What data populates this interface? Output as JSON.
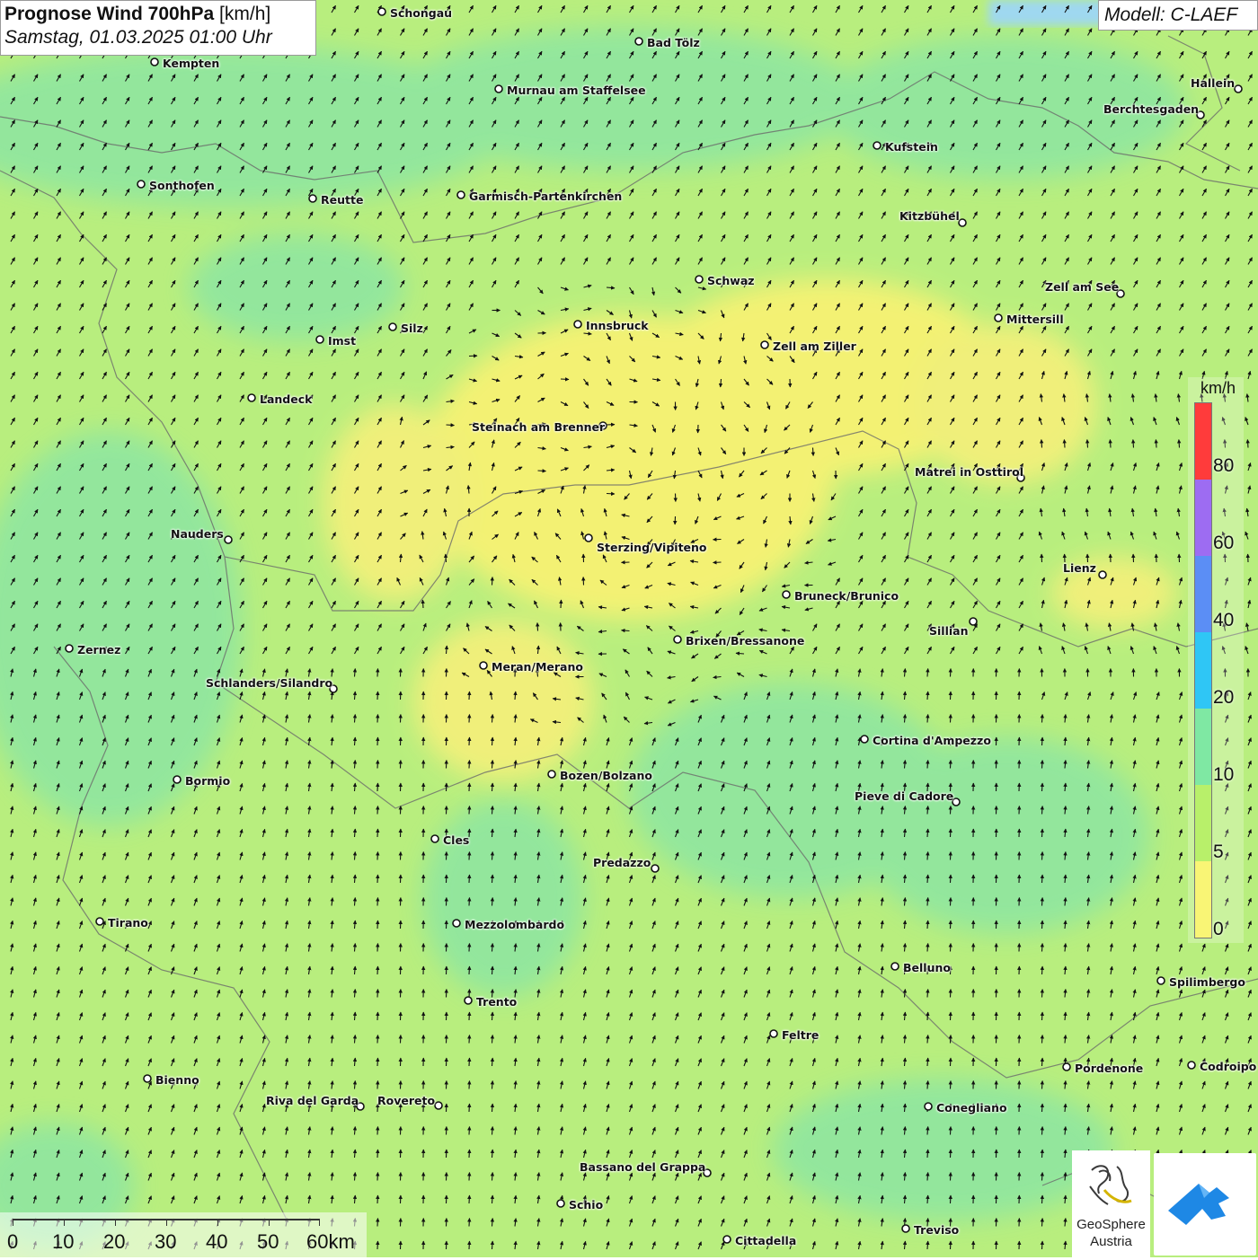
{
  "header": {
    "title_bold": "Prognose Wind 700hPa",
    "title_unit": "[km/h]",
    "datetime": "Samstag, 01.03.2025 01:00 Uhr"
  },
  "model": "Modell: C-LAEF",
  "legend": {
    "unit": "km/h",
    "ticks": [
      "80",
      "60",
      "40",
      "20",
      "10",
      "5",
      "0"
    ],
    "colors": [
      "#ff3b3b",
      "#9d6cf2",
      "#5b8ef5",
      "#2fc6f5",
      "#7fe8a3",
      "#b8f06a",
      "#f9f575"
    ]
  },
  "scalebar": {
    "labels": [
      "0",
      "10",
      "20",
      "30",
      "40",
      "50",
      "60km"
    ]
  },
  "logos": {
    "geosphere_name": "GeoSphere",
    "geosphere_sub": "Austria"
  },
  "cities": [
    {
      "name": "Schongau"
    },
    {
      "name": "Bad Tölz"
    },
    {
      "name": "Kempten"
    },
    {
      "name": "Murnau am Staffelsee"
    },
    {
      "name": "Hallein"
    },
    {
      "name": "Berchtesgaden"
    },
    {
      "name": "Kufstein"
    },
    {
      "name": "Sonthofen"
    },
    {
      "name": "Reutte"
    },
    {
      "name": "Garmisch-Partenkirchen"
    },
    {
      "name": "Kitzbühel"
    },
    {
      "name": "Schwaz"
    },
    {
      "name": "Zell am See"
    },
    {
      "name": "Mittersill"
    },
    {
      "name": "Innsbruck"
    },
    {
      "name": "Silz"
    },
    {
      "name": "Imst"
    },
    {
      "name": "Zell am Ziller"
    },
    {
      "name": "Landeck"
    },
    {
      "name": "Steinach am Brenner"
    },
    {
      "name": "Matrei in Osttirol"
    },
    {
      "name": "Nauders"
    },
    {
      "name": "Sterzing/Vipiteno"
    },
    {
      "name": "Lienz"
    },
    {
      "name": "Bruneck/Brunico"
    },
    {
      "name": "Sillian"
    },
    {
      "name": "Zernez"
    },
    {
      "name": "Brixen/Bressanone"
    },
    {
      "name": "Meran/Merano"
    },
    {
      "name": "Schlanders/Silandro"
    },
    {
      "name": "Cortina d'Ampezzo"
    },
    {
      "name": "Bozen/Bolzano"
    },
    {
      "name": "Bormio"
    },
    {
      "name": "Pieve di Cadore"
    },
    {
      "name": "Cles"
    },
    {
      "name": "Predazzo"
    },
    {
      "name": "Tirano"
    },
    {
      "name": "Mezzolombardo"
    },
    {
      "name": "Belluno"
    },
    {
      "name": "Spilimbergo"
    },
    {
      "name": "Trento"
    },
    {
      "name": "Feltre"
    },
    {
      "name": "Pordenone"
    },
    {
      "name": "Codroipo"
    },
    {
      "name": "Bienno"
    },
    {
      "name": "Riva del Garda"
    },
    {
      "name": "Rovereto"
    },
    {
      "name": "Conegliano"
    },
    {
      "name": "Bassano del Grappa"
    },
    {
      "name": "Schio"
    },
    {
      "name": "Treviso"
    },
    {
      "name": "Cittadella"
    }
  ]
}
